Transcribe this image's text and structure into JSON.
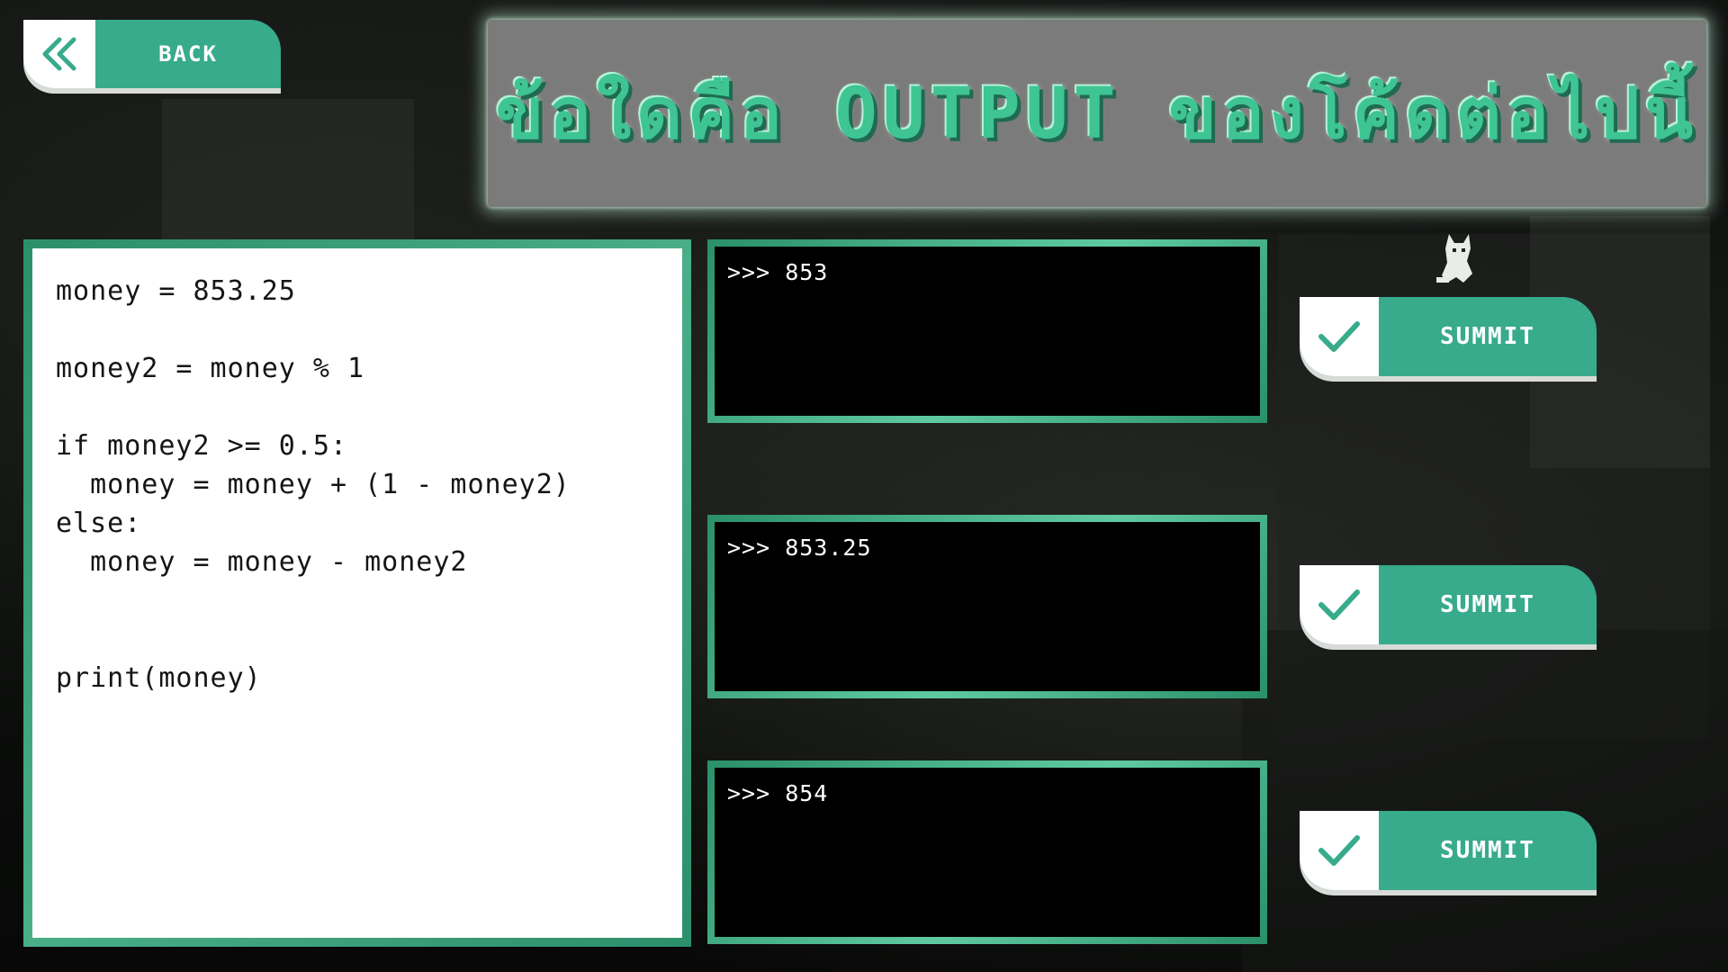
{
  "header": {
    "back_label": "BACK",
    "title": "ข้อใดคือ OUTPUT ของโค้ดต่อไปนี้"
  },
  "code": {
    "lines": [
      "money = 853.25",
      "",
      "money2 = money % 1",
      "",
      "if money2 >= 0.5:",
      "  money = money + (1 - money2)",
      "else:",
      "  money = money - money2",
      "",
      "",
      "print(money)"
    ]
  },
  "answers": [
    {
      "output": ">>> 853",
      "submit_label": "SUMMIT"
    },
    {
      "output": ">>> 853.25",
      "submit_label": "SUMMIT"
    },
    {
      "output": ">>> 854",
      "submit_label": "SUMMIT"
    }
  ],
  "icons": {
    "back": "double-chevron-left-icon",
    "submit": "checkmark-icon",
    "mascot": "cat-mascot-icon"
  },
  "colors": {
    "accent": "#37ab8c",
    "title_text": "#3fc494",
    "banner": "#7b7b7b",
    "answer_bg": "#000000",
    "code_bg": "#ffffff"
  }
}
